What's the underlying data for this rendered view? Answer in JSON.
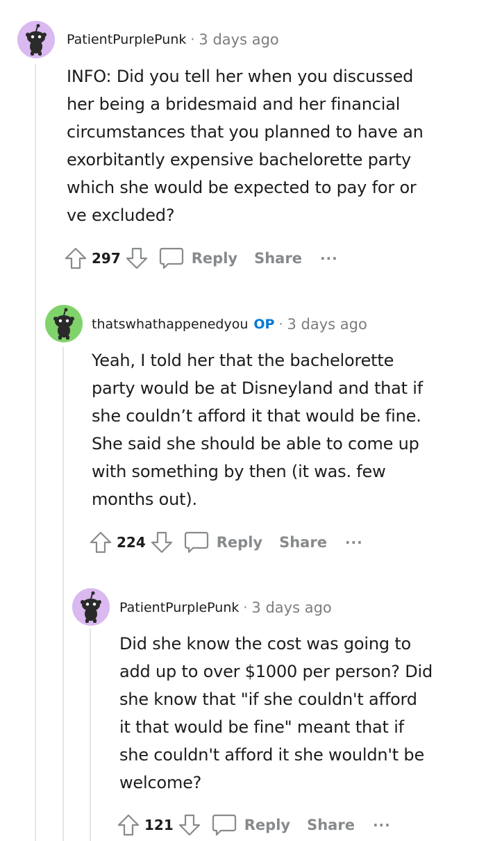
{
  "colors": {
    "avatar_purple": "#dab8f0",
    "avatar_green": "#7fd36a",
    "op_blue": "#0079d3",
    "muted": "#878a8c",
    "thread_line": "#e3e5e8"
  },
  "comments": [
    {
      "username": "PatientPurplePunk",
      "op_badge": "",
      "separator": "·",
      "time": "3 days ago",
      "body": "INFO: Did you tell her when you discussed\nher being a bridesmaid and her financial\ncircumstances that you planned to have an\nexorbitantly expensive bachelorette party\nwhich she would be expected to pay for or\nve excluded?",
      "score": "297",
      "reply_label": "Reply",
      "share_label": "Share",
      "more_label": "···",
      "avatar_icon": "snoo-avatar-icon"
    },
    {
      "username": "thatswhathappenedyou",
      "op_badge": "OP",
      "separator": "·",
      "time": "3 days ago",
      "body": "Yeah, I told her that the bachelorette\nparty would be at Disneyland and that if\nshe couldn’t afford it that would be fine.\nShe said she should be able to come up\nwith something by then (it was. few\nmonths out).",
      "score": "224",
      "reply_label": "Reply",
      "share_label": "Share",
      "more_label": "···",
      "avatar_icon": "snoo-avatar-icon"
    },
    {
      "username": "PatientPurplePunk",
      "op_badge": "",
      "separator": "·",
      "time": "3 days ago",
      "body": "Did she know the cost was going to\nadd up to over $1000 per person? Did\nshe know that \"if she couldn't afford\nit that would be fine\" meant that if\nshe couldn't afford it she wouldn't be\nwelcome?",
      "score": "121",
      "reply_label": "Reply",
      "share_label": "Share",
      "more_label": "···",
      "avatar_icon": "snoo-avatar-icon"
    }
  ]
}
